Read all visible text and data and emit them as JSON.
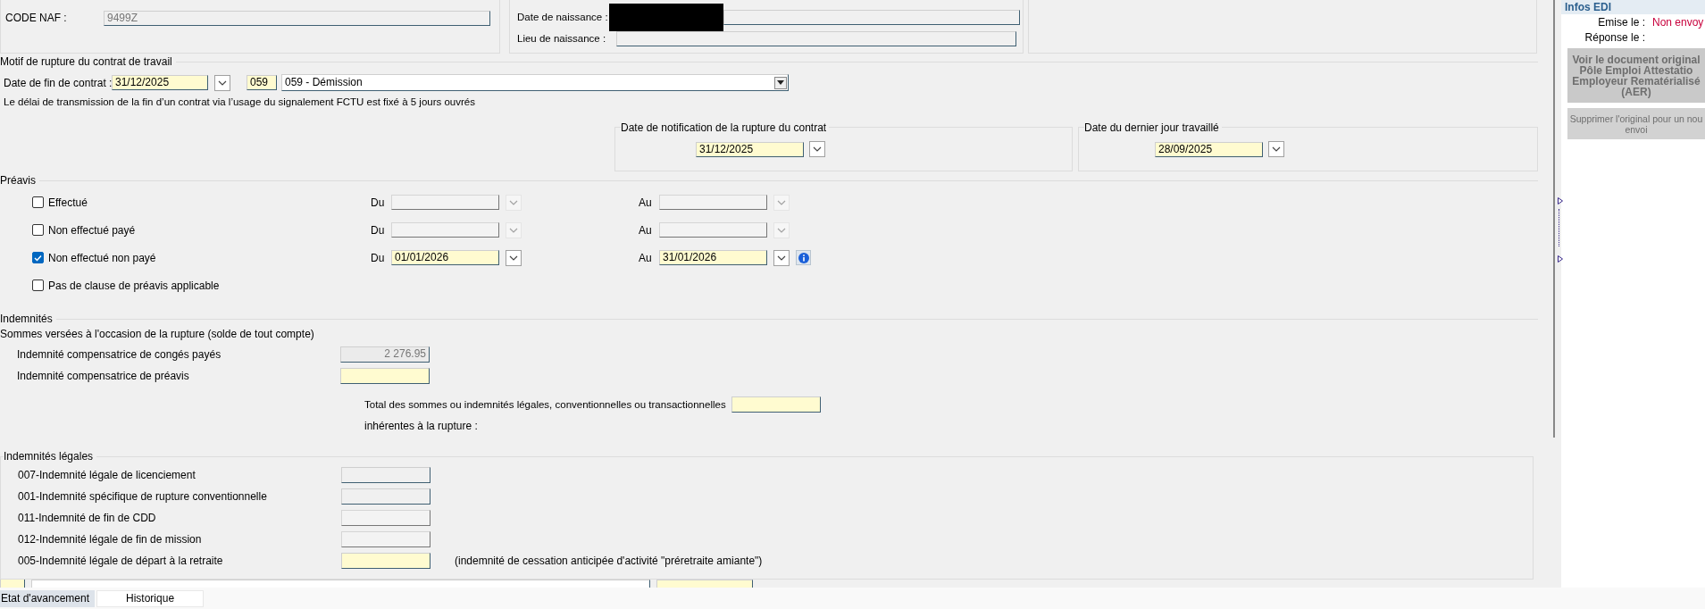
{
  "identity": {
    "code_naf": {
      "label": "CODE NAF :",
      "value": "9499Z",
      "disabled": true
    },
    "birth_date": {
      "label": "Date de naissance :",
      "redacted": true
    },
    "birth_place": {
      "label": "Lieu de naissance :"
    }
  },
  "motif": {
    "title": "Motif de rupture du contrat de travail",
    "end_date_label": "Date de fin de contrat :",
    "end_date": "31/12/2025",
    "code": "059",
    "reason": "059 - Démission",
    "notice": "Le délai de transmission de la fin d’un contrat via l’usage du signalement FCTU est fixé à 5 jours ouvrés"
  },
  "dates": [
    {
      "title": "Date de notification de la rupture du contrat",
      "value": "31/12/2025"
    },
    {
      "title": "Date du dernier jour travaillé",
      "value": "28/09/2025"
    }
  ],
  "preavis": {
    "title": "Préavis",
    "rows": [
      {
        "label": "Effectué",
        "checked": false,
        "from_label": "Du",
        "to_label": "Au",
        "disabled": true
      },
      {
        "label": "Non effectué payé",
        "checked": false,
        "from_label": "Du",
        "to_label": "Au",
        "disabled": true
      },
      {
        "label": "Non effectué non payé",
        "checked": true,
        "from_label": "Du",
        "from": "01/01/2026",
        "to_label": "Au",
        "to": "31/01/2026",
        "disabled": false,
        "info": true
      },
      {
        "label": "Pas de clause de préavis applicable",
        "checked": false
      }
    ]
  },
  "indemnites": {
    "title": "Indemnités",
    "subtitle": "Sommes versées à l'occasion de la rupture (solde de tout compte)",
    "rows": [
      {
        "label": "Indemnité compensatrice de congés payés",
        "value": "2 276.95",
        "kind": "readonly"
      },
      {
        "label": "Indemnité compensatrice de préavis",
        "kind": "required"
      }
    ],
    "total_label": "Total des sommes ou indemnités légales, conventionnelles ou transactionnelles",
    "total_label_2": "inhérentes à la rupture :"
  },
  "legales": {
    "title": "Indemnités légales",
    "rows": [
      {
        "label": "007-Indemnité légale de licenciement",
        "kind": "plain"
      },
      {
        "label": "001-Indemnité spécifique de rupture conventionnelle",
        "kind": "plain"
      },
      {
        "label": "011-Indemnité de fin de CDD",
        "kind": "disabled"
      },
      {
        "label": "012-Indemnité légale de fin de mission",
        "kind": "disabled"
      },
      {
        "label": "005-Indemnité légale de départ à la retraite",
        "kind": "required",
        "note": "(indemnité de cessation anticipée d'activité \"préretraite amiante\")"
      }
    ]
  },
  "side": {
    "header": "Infos EDI",
    "emise_label": "Emise le :",
    "emise_value": "Non envoy",
    "reponse_label": "Réponse le :",
    "buttons": [
      "Voir le document original Pôle Emploi Attestatio Employeur Rematérialisé (AER)",
      "Supprimer l'original pour un nou envoi"
    ]
  },
  "tabs": [
    {
      "label": "Etat d'avancement",
      "selected": true
    },
    {
      "label": "Historique",
      "selected": false
    }
  ]
}
